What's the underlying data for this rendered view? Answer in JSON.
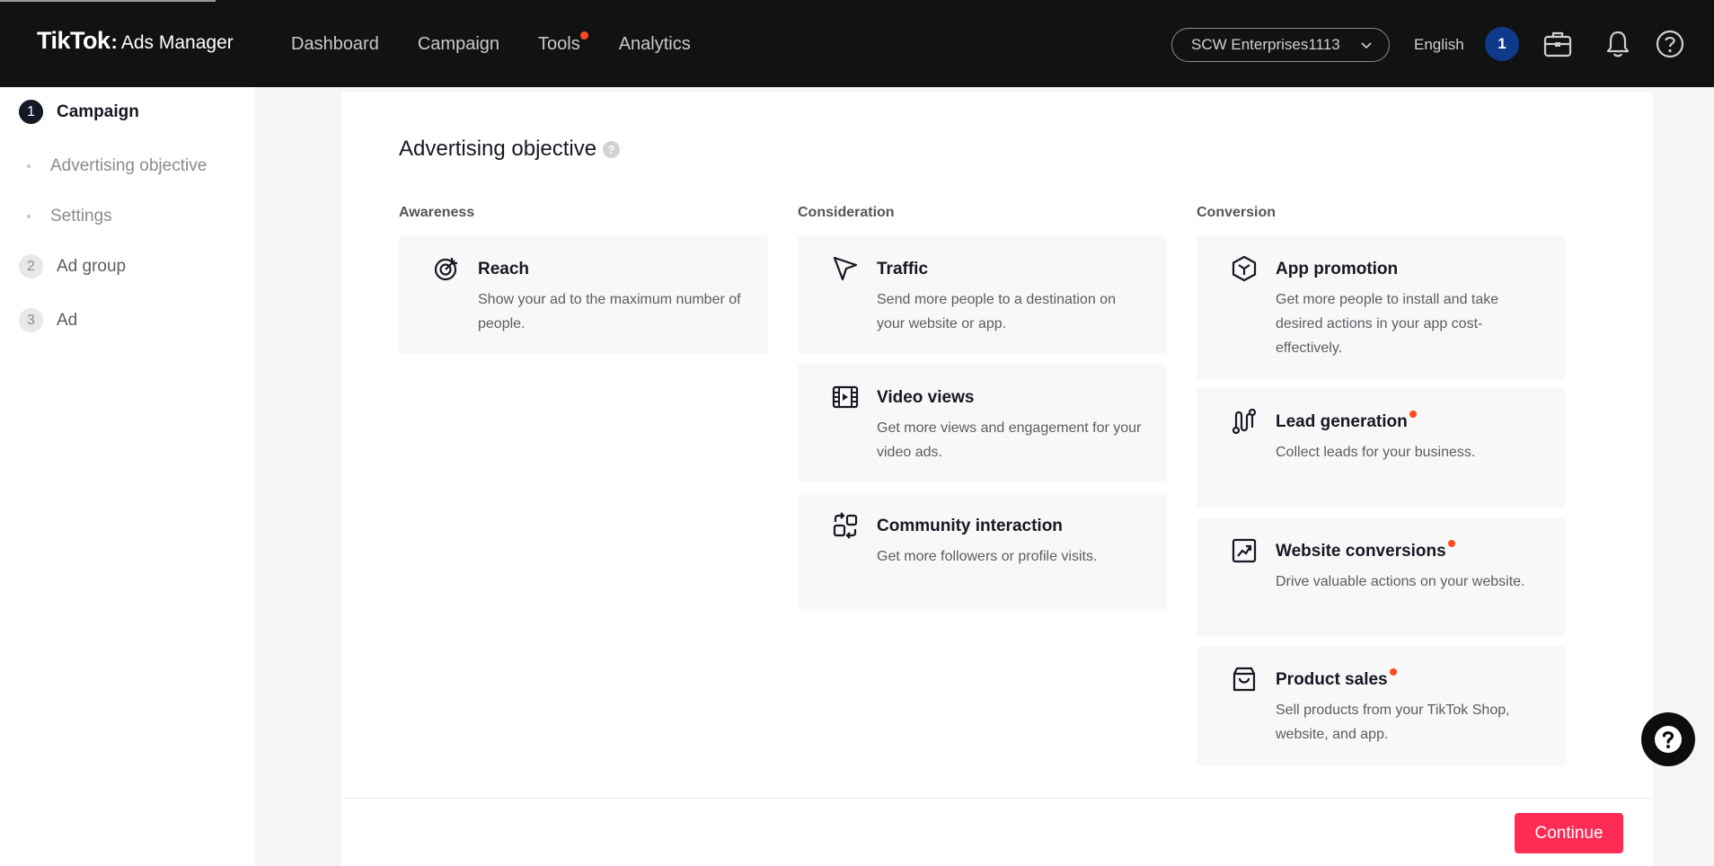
{
  "header": {
    "brand": "TikTok",
    "brand_separator": ":",
    "product": "Ads Manager",
    "nav": [
      {
        "label": "Dashboard",
        "has_dot": false
      },
      {
        "label": "Campaign",
        "has_dot": false
      },
      {
        "label": "Tools",
        "has_dot": true
      },
      {
        "label": "Analytics",
        "has_dot": false
      }
    ],
    "account": "SCW Enterprises1113",
    "language": "English",
    "avatar_text": "1",
    "icons": [
      "briefcase-icon",
      "bell-icon",
      "help-icon"
    ]
  },
  "sidebar": {
    "steps": [
      {
        "number": "1",
        "label": "Campaign",
        "active": true
      },
      {
        "number": "2",
        "label": "Ad group",
        "active": false
      },
      {
        "number": "3",
        "label": "Ad",
        "active": false
      }
    ],
    "substeps": [
      "Advertising objective",
      "Settings"
    ]
  },
  "main": {
    "heading": "Advertising objective",
    "help_symbol": "?",
    "columns": [
      {
        "title": "Awareness",
        "objectives": [
          {
            "icon": "target-icon",
            "title": "Reach",
            "description": "Show your ad to the maximum number of people.",
            "new_dot": false
          }
        ]
      },
      {
        "title": "Consideration",
        "objectives": [
          {
            "icon": "cursor-arrow-icon",
            "title": "Traffic",
            "description": "Send more people to a destination on your website or app.",
            "new_dot": false
          },
          {
            "icon": "video-film-icon",
            "title": "Video views",
            "description": "Get more views and engagement for your video ads.",
            "new_dot": false
          },
          {
            "icon": "community-swap-icon",
            "title": "Community interaction",
            "description": "Get more followers or profile visits.",
            "new_dot": false
          }
        ]
      },
      {
        "title": "Conversion",
        "objectives": [
          {
            "icon": "app-cube-icon",
            "title": "App promotion",
            "description": "Get more people to install and take desired actions in your app cost-effectively.",
            "new_dot": false
          },
          {
            "icon": "lead-path-icon",
            "title": "Lead generation",
            "description": "Collect leads for your business.",
            "new_dot": true
          },
          {
            "icon": "trend-chart-icon",
            "title": "Website conversions",
            "description": "Drive valuable actions on your website.",
            "new_dot": true
          },
          {
            "icon": "shopping-bag-icon",
            "title": "Product sales",
            "description": "Sell products from your TikTok Shop, website, and app.",
            "new_dot": true
          }
        ]
      }
    ]
  },
  "footer": {
    "continue_label": "Continue"
  },
  "colors": {
    "accent": "#fe2c55",
    "topbar": "#121212",
    "new_dot": "#ff4b1f",
    "avatar": "#0e3a8a"
  }
}
